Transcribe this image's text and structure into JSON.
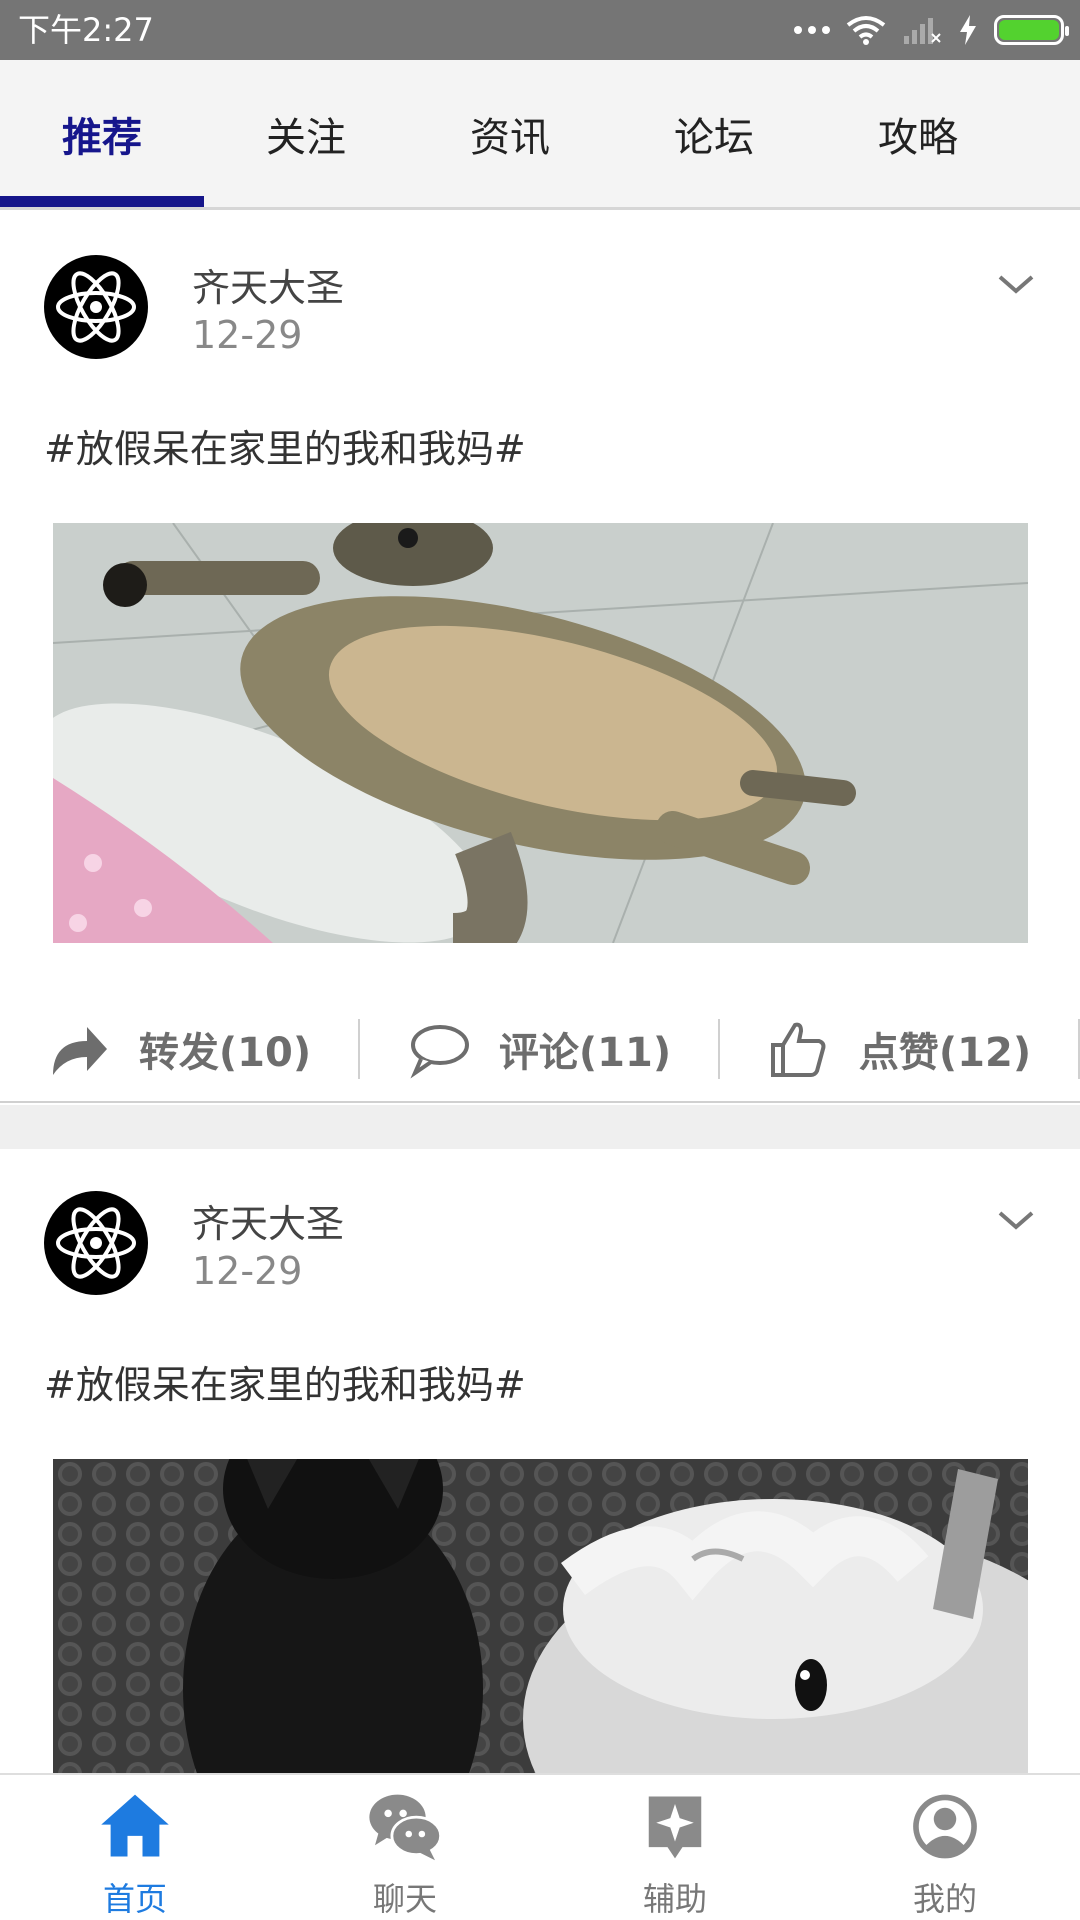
{
  "status_bar": {
    "time": "下午2:27"
  },
  "tabs": [
    {
      "label": "推荐",
      "active": true
    },
    {
      "label": "关注",
      "active": false
    },
    {
      "label": "资讯",
      "active": false
    },
    {
      "label": "论坛",
      "active": false
    },
    {
      "label": "攻略",
      "active": false
    }
  ],
  "posts": [
    {
      "username": "齐天大圣",
      "date": "12-29",
      "text": "#放假呆在家里的我和我妈#",
      "image": "cat-lying-on-floor",
      "repost_label": "转发(10)",
      "comment_label": "评论(11)",
      "like_label": "点赞(12)"
    },
    {
      "username": "齐天大圣",
      "date": "12-29",
      "text": "#放假呆在家里的我和我妈#",
      "image": "black-cat-and-unicorn-plush"
    }
  ],
  "bottom_nav": [
    {
      "label": "首页",
      "icon": "home-icon",
      "active": true
    },
    {
      "label": "聊天",
      "icon": "chat-icon",
      "active": false
    },
    {
      "label": "辅助",
      "icon": "assist-icon",
      "active": false
    },
    {
      "label": "我的",
      "icon": "profile-icon",
      "active": false
    }
  ],
  "colors": {
    "accent": "#16168c",
    "nav_active": "#1e7be0",
    "status_bar": "#757575",
    "battery": "#53d22f"
  }
}
